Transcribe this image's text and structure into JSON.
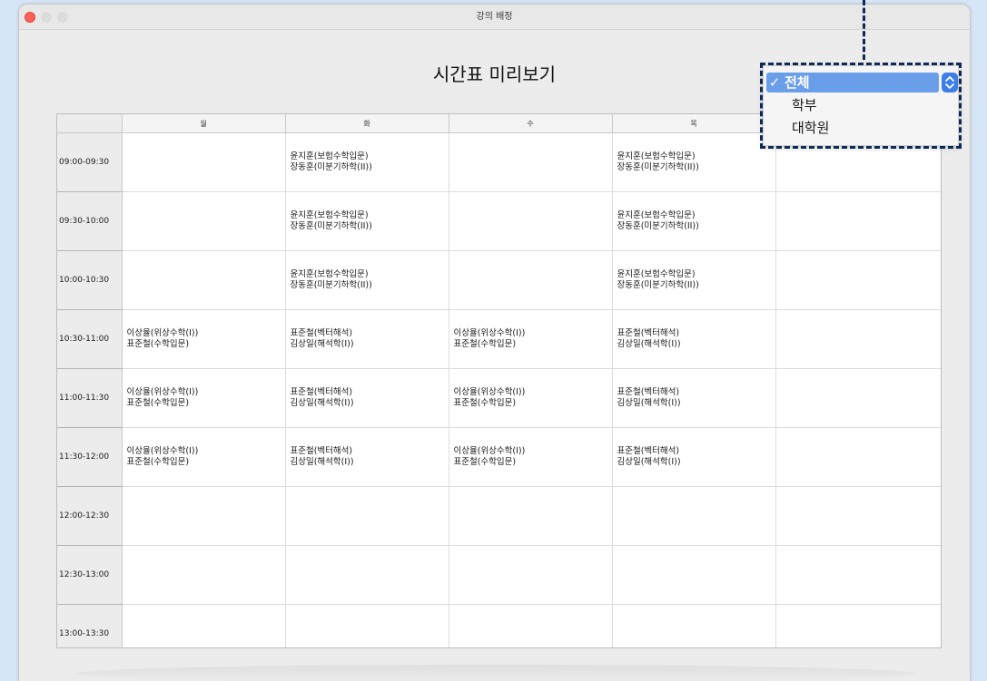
{
  "window": {
    "title": "강의 배정"
  },
  "page": {
    "title": "시간표 미리보기"
  },
  "timetable": {
    "days": [
      "월",
      "화",
      "수",
      "목",
      ""
    ],
    "rows": [
      {
        "time": "09:00-09:30",
        "cells": [
          [],
          [
            "윤지훈(보험수학입문)",
            "장동훈(미분기하학(II))"
          ],
          [],
          [
            "윤지훈(보험수학입문)",
            "장동훈(미분기하학(II))"
          ],
          []
        ]
      },
      {
        "time": "09:30-10:00",
        "cells": [
          [],
          [
            "윤지훈(보험수학입문)",
            "장동훈(미분기하학(II))"
          ],
          [],
          [
            "윤지훈(보험수학입문)",
            "장동훈(미분기하학(II))"
          ],
          []
        ]
      },
      {
        "time": "10:00-10:30",
        "cells": [
          [],
          [
            "윤지훈(보험수학입문)",
            "장동훈(미분기하학(II))"
          ],
          [],
          [
            "윤지훈(보험수학입문)",
            "장동훈(미분기하학(II))"
          ],
          []
        ]
      },
      {
        "time": "10:30-11:00",
        "cells": [
          [
            "이상율(위상수학(I))",
            "표준철(수학입문)"
          ],
          [
            "표준철(벡터해석)",
            "김상일(해석학(I))"
          ],
          [
            "이상율(위상수학(I))",
            "표준철(수학입문)"
          ],
          [
            "표준철(벡터해석)",
            "김상일(해석학(I))"
          ],
          []
        ]
      },
      {
        "time": "11:00-11:30",
        "cells": [
          [
            "이상율(위상수학(I))",
            "표준철(수학입문)"
          ],
          [
            "표준철(벡터해석)",
            "김상일(해석학(I))"
          ],
          [
            "이상율(위상수학(I))",
            "표준철(수학입문)"
          ],
          [
            "표준철(벡터해석)",
            "김상일(해석학(I))"
          ],
          []
        ]
      },
      {
        "time": "11:30-12:00",
        "cells": [
          [
            "이상율(위상수학(I))",
            "표준철(수학입문)"
          ],
          [
            "표준철(벡터해석)",
            "김상일(해석학(I))"
          ],
          [
            "이상율(위상수학(I))",
            "표준철(수학입문)"
          ],
          [
            "표준철(벡터해석)",
            "김상일(해석학(I))"
          ],
          []
        ]
      },
      {
        "time": "12:00-12:30",
        "cells": [
          [],
          [],
          [],
          [],
          []
        ]
      },
      {
        "time": "12:30-13:00",
        "cells": [
          [],
          [],
          [],
          [],
          []
        ]
      },
      {
        "time": "13:00-13:30",
        "cells": [
          [],
          [],
          [],
          [],
          []
        ]
      }
    ]
  },
  "filter_dropdown": {
    "options": [
      "전체",
      "학부",
      "대학원"
    ],
    "selected_index": 0,
    "check_mark": "✓",
    "stepper_icon": "up-down-chevron-icon"
  },
  "colors": {
    "highlight": "#6a9ee8",
    "stepper": "#3e7ee8",
    "annotation_dash": "#0d2a57",
    "background": "#d6e6f7"
  }
}
